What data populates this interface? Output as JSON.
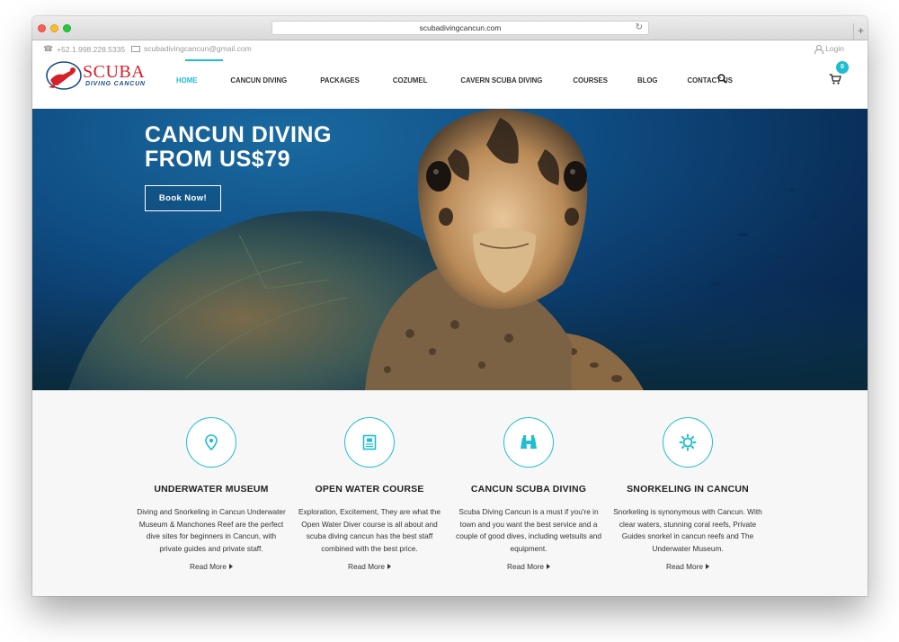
{
  "browser": {
    "url": "scubadivingcancun.com",
    "new_tab_glyph": "+"
  },
  "topbar": {
    "phone": "+52.1.998.228.5335",
    "email": "scubadivingcancun@gmail.com",
    "login": "Login"
  },
  "logo": {
    "name": "SCUBA",
    "tagline": "DIVING CANCUN"
  },
  "nav": {
    "items": [
      {
        "label": "HOME",
        "active": true
      },
      {
        "label": "CANCUN DIVING",
        "active": false
      },
      {
        "label": "PACKAGES",
        "active": false
      },
      {
        "label": "COZUMEL",
        "active": false
      },
      {
        "label": "CAVERN SCUBA DIVING",
        "active": false
      },
      {
        "label": "COURSES",
        "active": false
      },
      {
        "label": "BLOG",
        "active": false
      },
      {
        "label": "CONTACT US",
        "active": false
      }
    ],
    "cart_count": "0",
    "accent_color": "#1ebdd1"
  },
  "hero": {
    "title_line1": "CANCUN DIVING",
    "title_line2": "FROM US$79",
    "button": "Book Now!"
  },
  "features": [
    {
      "icon": "map-pin-icon",
      "title": "UNDERWATER MUSEUM",
      "text": "Diving and Snorkeling in Cancun Underwater Museum & Manchones Reef are the perfect dive sites for beginners in Cancun, with private guides and private staff.",
      "more": "Read More"
    },
    {
      "icon": "certificate-icon",
      "title": "OPEN WATER COURSE",
      "text": "Exploration, Excitement, They are what the Open Water Diver course is all about and scuba diving cancun has the best staff combined with the best price.",
      "more": "Read More"
    },
    {
      "icon": "binoculars-icon",
      "title": "CANCUN SCUBA DIVING",
      "text": "Scuba Diving Cancun is a must if you're in town and you want the best service and a couple of good dives, including wetsuits and equipment.",
      "more": "Read More"
    },
    {
      "icon": "sun-icon",
      "title": "SNORKELING IN CANCUN",
      "text": "Snorkeling is synonymous with Cancun. With clear waters, stunning coral reefs, Private Guides snorkel in cancun reefs and The Underwater Museum.",
      "more": "Read More"
    }
  ]
}
